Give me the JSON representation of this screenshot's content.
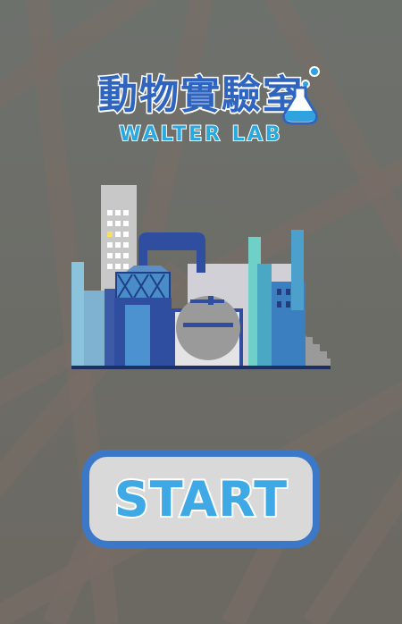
{
  "title": {
    "chinese": "動物實驗室",
    "english": "WALTER LAB"
  },
  "start_button": {
    "label": "START"
  },
  "icons": [
    "flask-icon",
    "factory-illustration"
  ],
  "colors": {
    "background": "#6e6a62",
    "title_blue": "#2f64bf",
    "subtitle_blue": "#29a9e0",
    "button_fill": "#d9d9d9",
    "button_border": "#3b79c8",
    "button_text": "#3fa9e6"
  }
}
